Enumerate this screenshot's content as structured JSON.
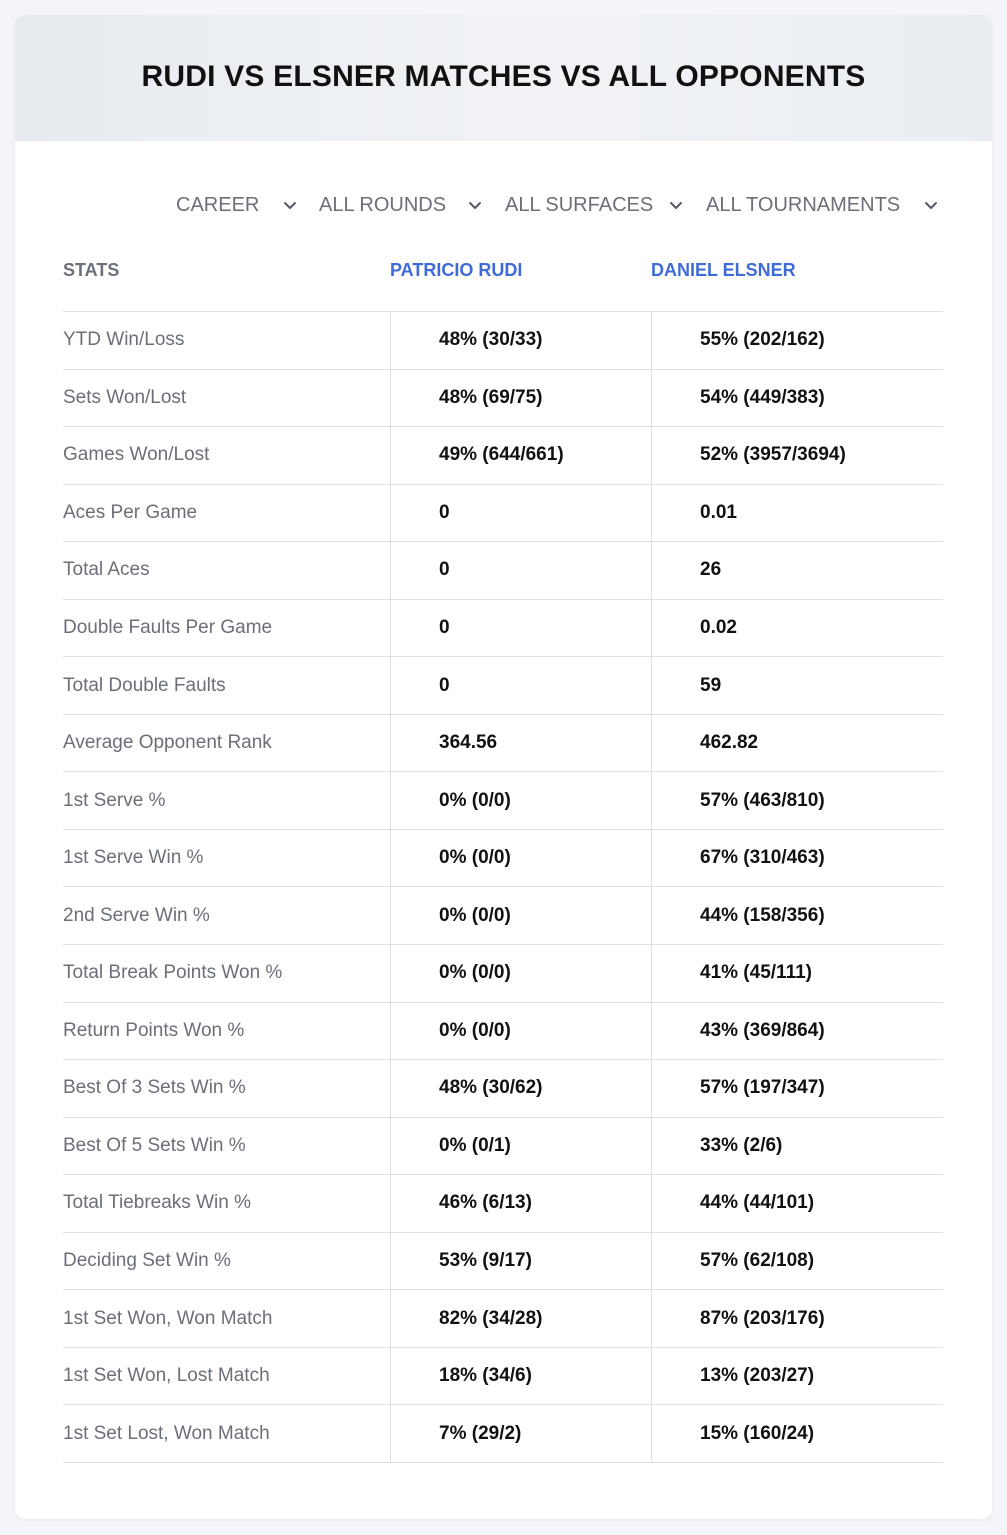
{
  "title": "RUDI VS ELSNER MATCHES VS ALL OPPONENTS",
  "filters": [
    {
      "label": "CAREER"
    },
    {
      "label": "ALL ROUNDS"
    },
    {
      "label": "ALL SURFACES"
    },
    {
      "label": "ALL TOURNAMENTS"
    }
  ],
  "columns": {
    "stats": "STATS",
    "player1": "PATRICIO RUDI",
    "player2": "DANIEL ELSNER"
  },
  "rows": [
    {
      "label": "YTD Win/Loss",
      "p1": "48% (30/33)",
      "p2": "55% (202/162)"
    },
    {
      "label": "Sets Won/Lost",
      "p1": "48% (69/75)",
      "p2": "54% (449/383)"
    },
    {
      "label": "Games Won/Lost",
      "p1": "49% (644/661)",
      "p2": "52% (3957/3694)"
    },
    {
      "label": "Aces Per Game",
      "p1": "0",
      "p2": "0.01"
    },
    {
      "label": "Total Aces",
      "p1": "0",
      "p2": "26"
    },
    {
      "label": "Double Faults Per Game",
      "p1": "0",
      "p2": "0.02"
    },
    {
      "label": "Total Double Faults",
      "p1": "0",
      "p2": "59"
    },
    {
      "label": "Average Opponent Rank",
      "p1": "364.56",
      "p2": "462.82"
    },
    {
      "label": "1st Serve %",
      "p1": "0% (0/0)",
      "p2": "57% (463/810)"
    },
    {
      "label": "1st Serve Win %",
      "p1": "0% (0/0)",
      "p2": "67% (310/463)"
    },
    {
      "label": "2nd Serve Win %",
      "p1": "0% (0/0)",
      "p2": "44% (158/356)"
    },
    {
      "label": "Total Break Points Won %",
      "p1": "0% (0/0)",
      "p2": "41% (45/111)"
    },
    {
      "label": "Return Points Won %",
      "p1": "0% (0/0)",
      "p2": "43% (369/864)"
    },
    {
      "label": "Best Of 3 Sets Win %",
      "p1": "48% (30/62)",
      "p2": "57% (197/347)"
    },
    {
      "label": "Best Of 5 Sets Win %",
      "p1": "0% (0/1)",
      "p2": "33% (2/6)"
    },
    {
      "label": "Total Tiebreaks Win %",
      "p1": "46% (6/13)",
      "p2": "44% (44/101)"
    },
    {
      "label": "Deciding Set Win %",
      "p1": "53% (9/17)",
      "p2": "57% (62/108)"
    },
    {
      "label": "1st Set Won, Won Match",
      "p1": "82% (34/28)",
      "p2": "87% (203/176)"
    },
    {
      "label": "1st Set Won, Lost Match",
      "p1": "18% (34/6)",
      "p2": "13% (203/27)"
    },
    {
      "label": "1st Set Lost, Won Match",
      "p1": "7% (29/2)",
      "p2": "15% (160/24)"
    }
  ],
  "colors": {
    "accent": "#3f6bd8",
    "label_text": "#6a6f78",
    "value_text": "#111111",
    "divider": "#dcdfe4"
  }
}
